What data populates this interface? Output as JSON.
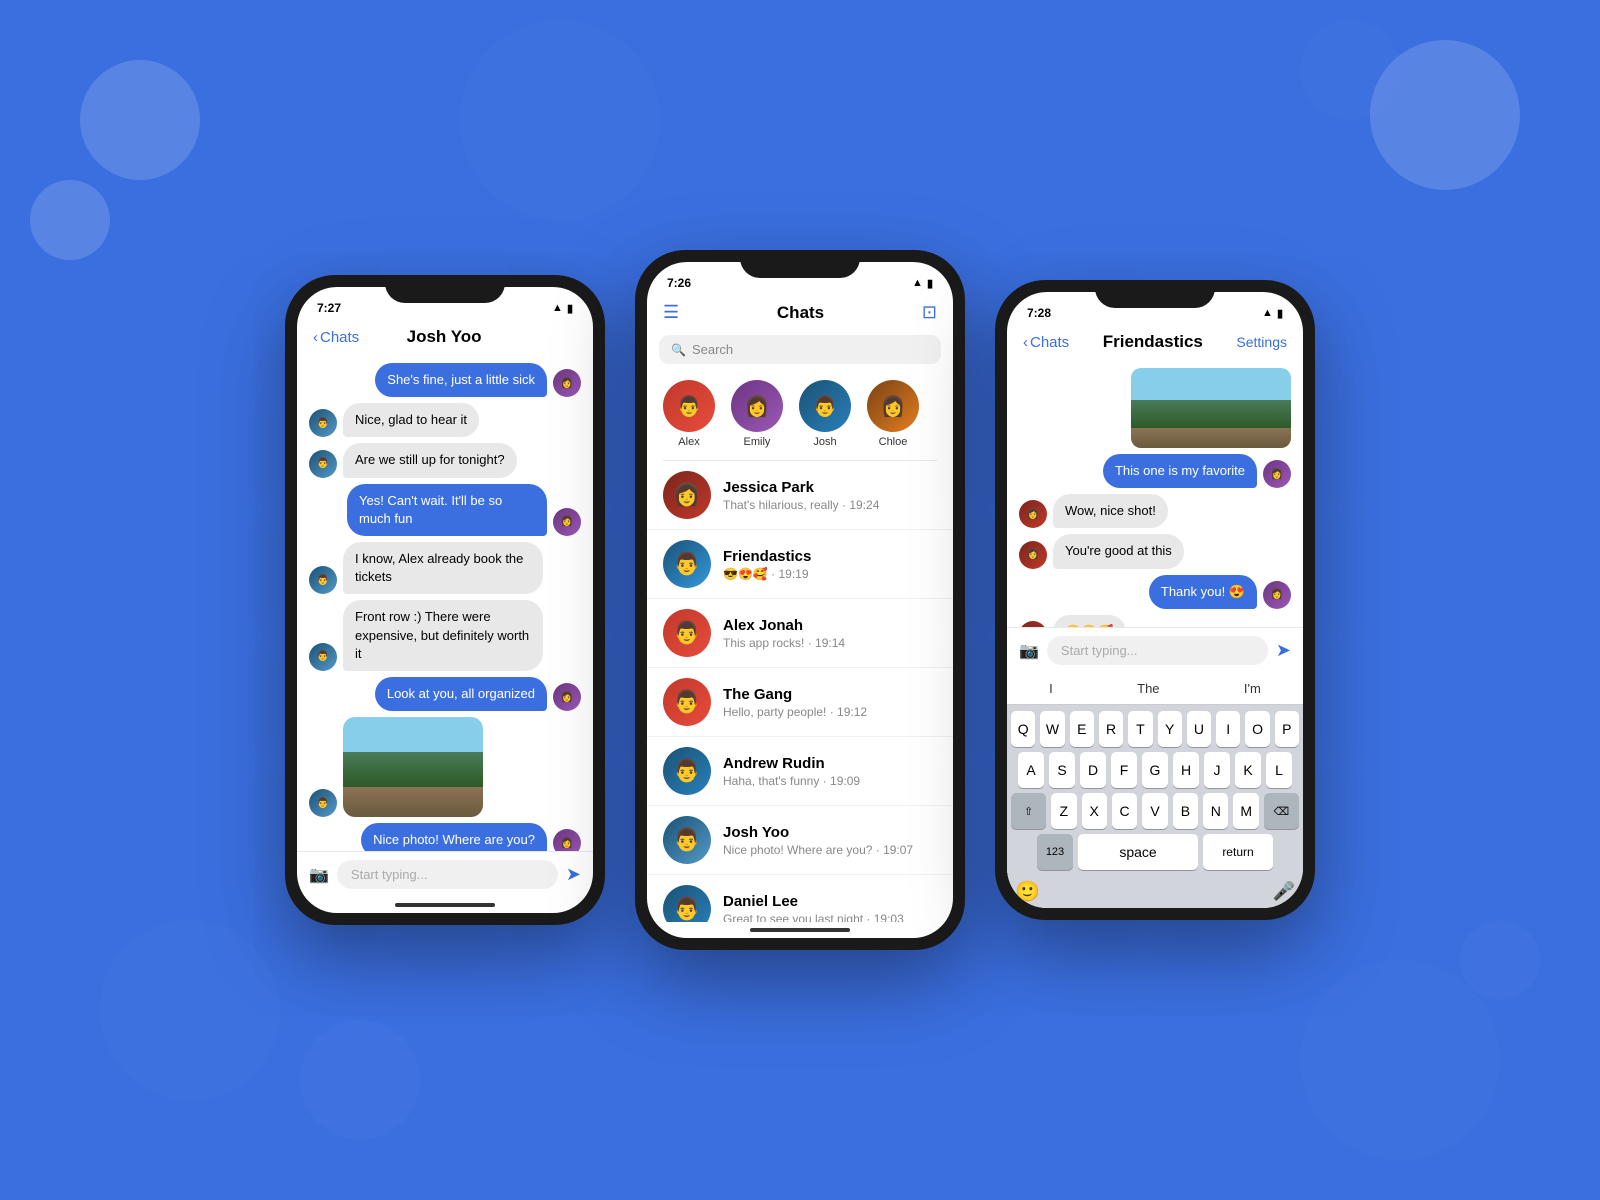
{
  "background": {
    "color": "#3B6FE0"
  },
  "phones": {
    "left": {
      "time": "7:27",
      "nav": {
        "back": "Chats",
        "title": "Josh Yoo"
      },
      "messages": [
        {
          "type": "sent",
          "text": "She's fine, just a little sick"
        },
        {
          "type": "received",
          "text": "Nice, glad to hear it"
        },
        {
          "type": "received",
          "text": "Are we still up for tonight?"
        },
        {
          "type": "sent",
          "text": "Yes! Can't wait. It'll be so much fun"
        },
        {
          "type": "received",
          "text": "I know, Alex already book the tickets"
        },
        {
          "type": "received",
          "text": "Front row :) There were expensive, but definitely worth it"
        },
        {
          "type": "sent",
          "text": "Look at you, all organized"
        },
        {
          "type": "received",
          "image": true
        },
        {
          "type": "sent",
          "text": "Nice photo! Where are you?"
        }
      ],
      "input_placeholder": "Start typing..."
    },
    "center": {
      "time": "7:26",
      "nav": {
        "title": "Chats",
        "left_icon": "menu",
        "right_icon": "compose"
      },
      "search_placeholder": "Search",
      "stories": [
        {
          "name": "Alex",
          "color": "#c0392b"
        },
        {
          "name": "Emily",
          "color": "#6c3483"
        },
        {
          "name": "Josh",
          "color": "#1a5276"
        },
        {
          "name": "Chloe",
          "color": "#784212"
        }
      ],
      "chats": [
        {
          "name": "Jessica Park",
          "preview": "That's hilarious, really · 19:24"
        },
        {
          "name": "Friendastics",
          "preview": "😎😍🥰 · 19:19"
        },
        {
          "name": "Alex Jonah",
          "preview": "This app rocks! · 19:14"
        },
        {
          "name": "The Gang",
          "preview": "Hello, party people! · 19:12"
        },
        {
          "name": "Andrew Rudin",
          "preview": "Haha, that's funny · 19:09"
        },
        {
          "name": "Josh Yoo",
          "preview": "Nice photo! Where are you? · 19:07"
        },
        {
          "name": "Daniel Lee",
          "preview": "Great to see you last night · 19:03"
        }
      ]
    },
    "right": {
      "time": "7:28",
      "nav": {
        "back": "Chats",
        "title": "Friendastics",
        "action": "Settings"
      },
      "messages": [
        {
          "type": "image_sent"
        },
        {
          "type": "sent",
          "text": "This one is my favorite"
        },
        {
          "type": "received",
          "text": "Wow, nice shot!"
        },
        {
          "type": "received",
          "text": "You're good at this"
        },
        {
          "type": "sent",
          "text": "Thank you! 😍"
        },
        {
          "type": "emoji_received",
          "emojis": "😎😍🥰"
        }
      ],
      "input_placeholder": "Start typing...",
      "keyboard": {
        "suggestions": [
          "I",
          "The",
          "I'm"
        ],
        "rows": [
          [
            "Q",
            "W",
            "E",
            "R",
            "T",
            "Y",
            "U",
            "I",
            "O",
            "P"
          ],
          [
            "A",
            "S",
            "D",
            "F",
            "G",
            "H",
            "J",
            "K",
            "L"
          ],
          [
            "⇧",
            "Z",
            "X",
            "C",
            "V",
            "B",
            "N",
            "M",
            "⌫"
          ],
          [
            "123",
            "space",
            "return"
          ]
        ]
      }
    }
  }
}
